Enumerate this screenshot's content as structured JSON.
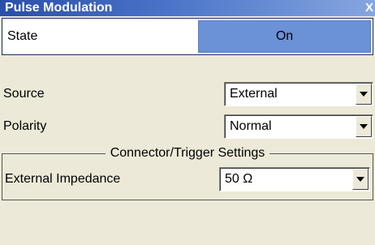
{
  "window": {
    "title": "Pulse Modulation",
    "close_glyph": "X"
  },
  "state": {
    "label": "State",
    "value": "On"
  },
  "source": {
    "label": "Source",
    "value": "External"
  },
  "polarity": {
    "label": "Polarity",
    "value": "Normal"
  },
  "connector_group": {
    "title": "Connector/Trigger Settings",
    "impedance_label": "External Impedance",
    "impedance_value": "50 Ω"
  },
  "icons": {
    "dropdown": "chevron-down-icon",
    "close": "close-icon"
  },
  "colors": {
    "titlebar_start": "#2a4fa8",
    "titlebar_end": "#86a6df",
    "state_button": "#6b91d6",
    "panel": "#ece9d8"
  }
}
